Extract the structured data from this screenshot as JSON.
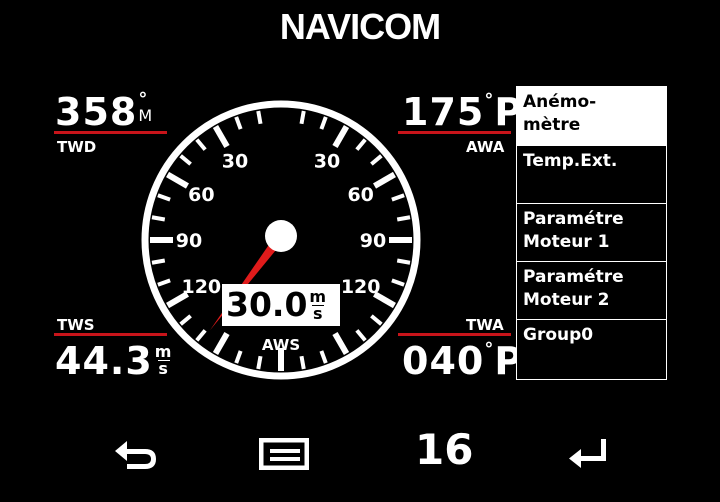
{
  "header": {
    "brand": "NAVICOM"
  },
  "readouts": {
    "twd": {
      "label": "TWD",
      "value": "358",
      "unit_top": "°",
      "unit_bottom": "M"
    },
    "awa": {
      "label": "AWA",
      "value": "175",
      "unit_top": "°",
      "unit_bottom": "P"
    },
    "tws": {
      "label": "TWS",
      "value": "44.3",
      "unit_top": "m",
      "unit_bottom": "s"
    },
    "twa": {
      "label": "TWA",
      "value": "040",
      "unit_top": "°",
      "unit_bottom": "P"
    }
  },
  "gauge": {
    "label": "AWS",
    "value": "30.0",
    "unit_top": "m",
    "unit_bottom": "s",
    "needle_angle_deg": 217,
    "scale_labels": [
      "30",
      "60",
      "90",
      "120",
      "30",
      "60",
      "90",
      "120"
    ],
    "colors": {
      "needle": "#e01b1b",
      "dial": "#ffffff",
      "rule": "#c8141a"
    }
  },
  "menu": {
    "items": [
      {
        "label": "Anémo-\nmètre",
        "active": true
      },
      {
        "label": "Temp.Ext.",
        "active": false
      },
      {
        "label": "Paramétre\nMoteur 1",
        "active": false
      },
      {
        "label": "Paramétre\nMoteur 2",
        "active": false
      },
      {
        "label": "Group0",
        "active": false
      }
    ]
  },
  "footer": {
    "page_number": "16",
    "icons": [
      "back-arrow-icon",
      "menu-list-icon",
      "enter-return-icon"
    ]
  }
}
